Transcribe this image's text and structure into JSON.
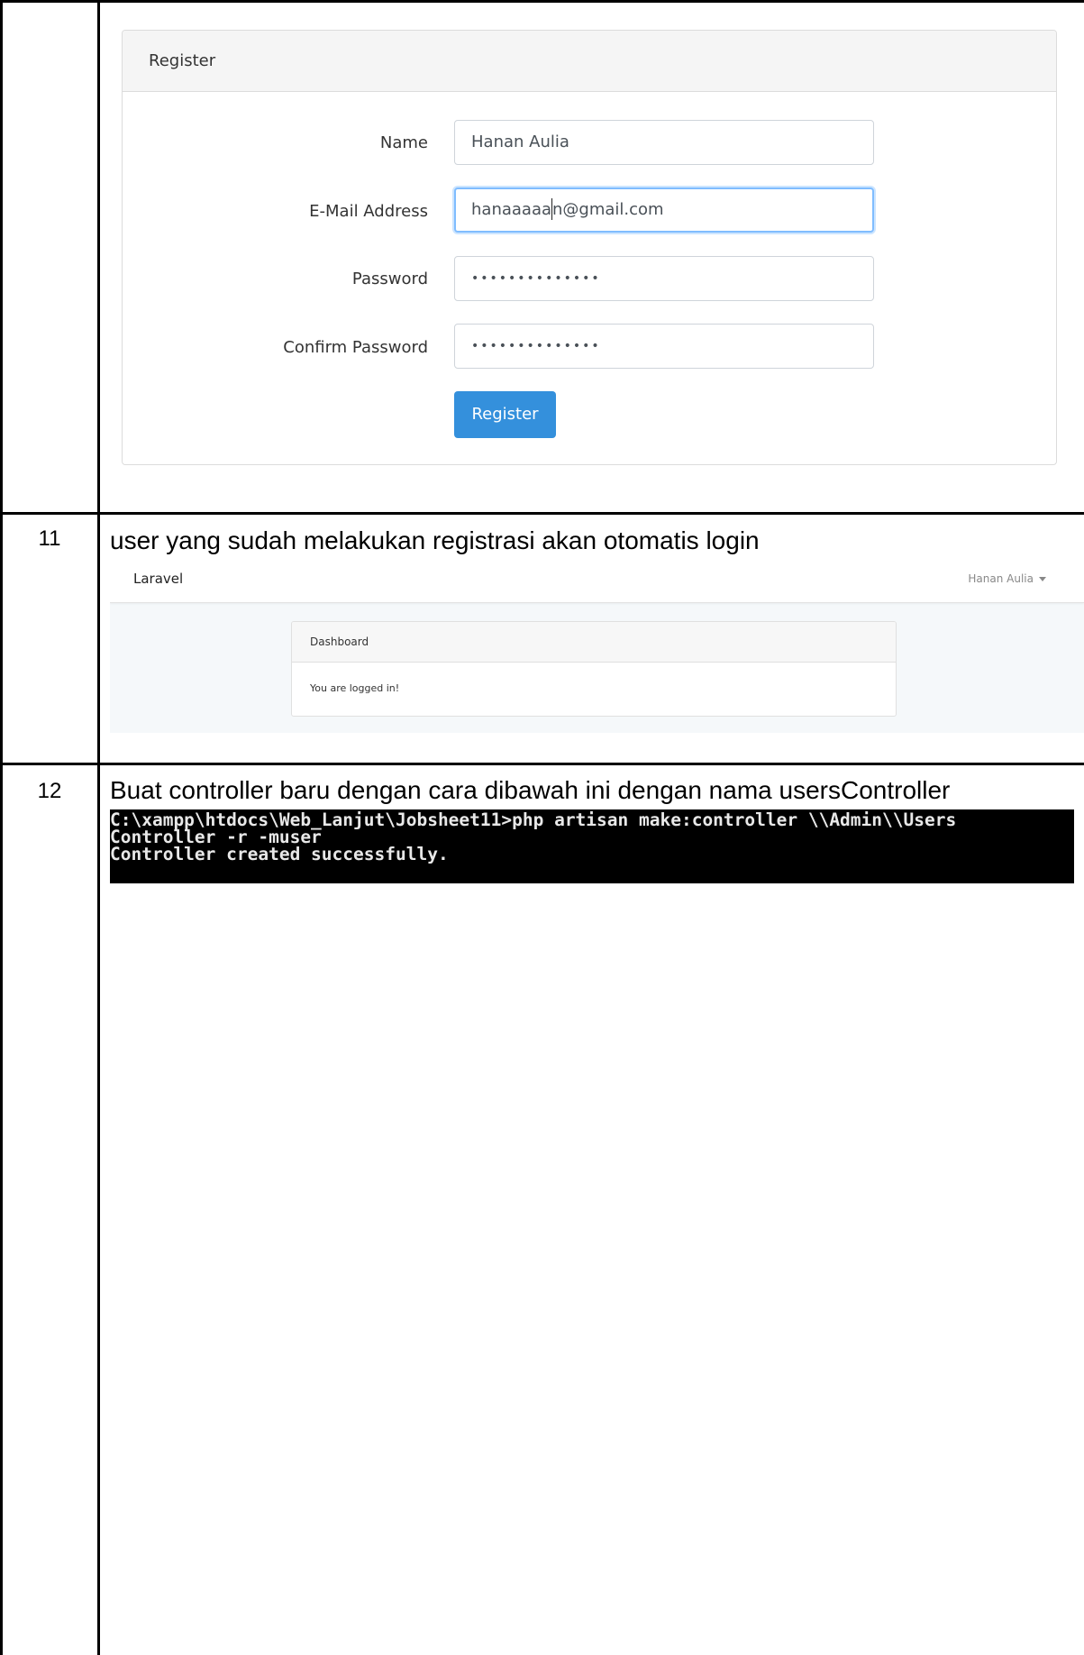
{
  "rows": [
    {
      "number": "",
      "caption": ""
    },
    {
      "number": "11",
      "caption": "user yang sudah melakukan registrasi akan otomatis login"
    },
    {
      "number": "12",
      "caption": "Buat controller baru dengan cara dibawah ini dengan nama usersController"
    }
  ],
  "register": {
    "card_title": "Register",
    "name_label": "Name",
    "name_value": "Hanan Aulia",
    "email_label": "E-Mail Address",
    "email_value_before_caret": "hanaaaaa",
    "email_value_after_caret": "n@gmail.com",
    "password_label": "Password",
    "password_mask": "••••••••••••••",
    "confirm_label": "Confirm Password",
    "confirm_mask": "••••••••••••••",
    "button_label": "Register",
    "button_color": "#3490dc"
  },
  "dashboard": {
    "brand": "Laravel",
    "user_name": "Hanan Aulia",
    "card_title": "Dashboard",
    "message": "You are logged in!"
  },
  "terminal": {
    "lines": [
      "C:\\xampp\\htdocs\\Web_Lanjut\\Jobsheet11>php artisan make:controller \\\\Admin\\\\Users",
      "Controller -r -muser",
      "Controller created successfully."
    ]
  }
}
